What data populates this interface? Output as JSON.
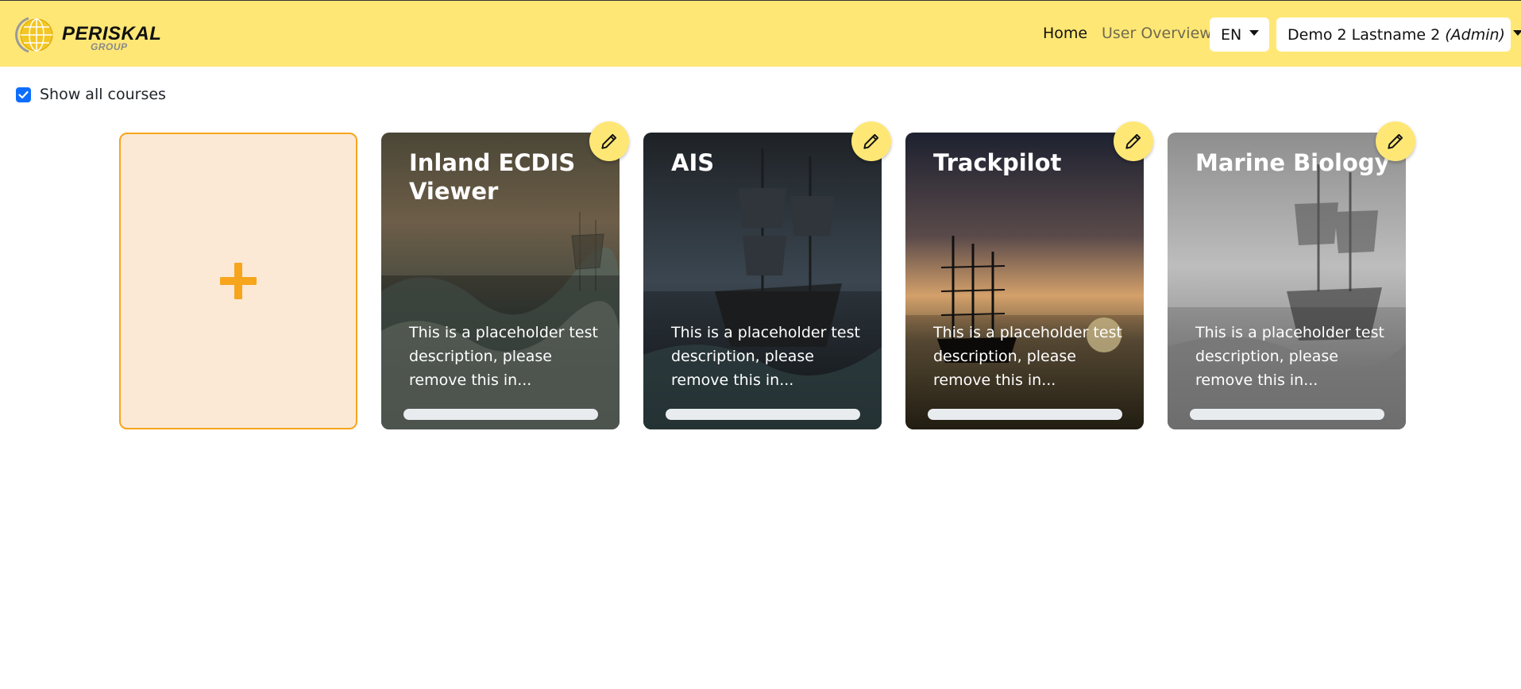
{
  "header": {
    "brand_name": "PERISKAL",
    "brand_sub": "GROUP",
    "nav": {
      "home": "Home",
      "user_overview": "User Overview"
    },
    "language": "EN",
    "user": {
      "name": "Demo 2 Lastname 2",
      "role": "(Admin)"
    }
  },
  "filters": {
    "show_all_label": "Show all courses",
    "show_all_checked": true
  },
  "add_card": {
    "symbol": "+"
  },
  "courses": [
    {
      "title": "Inland ECDIS Viewer",
      "description": "This is a placeholder test description, please remove this in...",
      "progress": 0
    },
    {
      "title": "AIS",
      "description": "This is a placeholder test description, please remove this in...",
      "progress": 0
    },
    {
      "title": "Trackpilot",
      "description": "This is a placeholder test description, please remove this in...",
      "progress": 0
    },
    {
      "title": "Marine Biology",
      "description": "This is a placeholder test description, please remove this in...",
      "progress": 0
    }
  ],
  "colors": {
    "navbar": "#ffe775",
    "accent": "#f7a51c",
    "add_card_bg": "#fbe9d6",
    "checkbox": "#0d6efd"
  }
}
